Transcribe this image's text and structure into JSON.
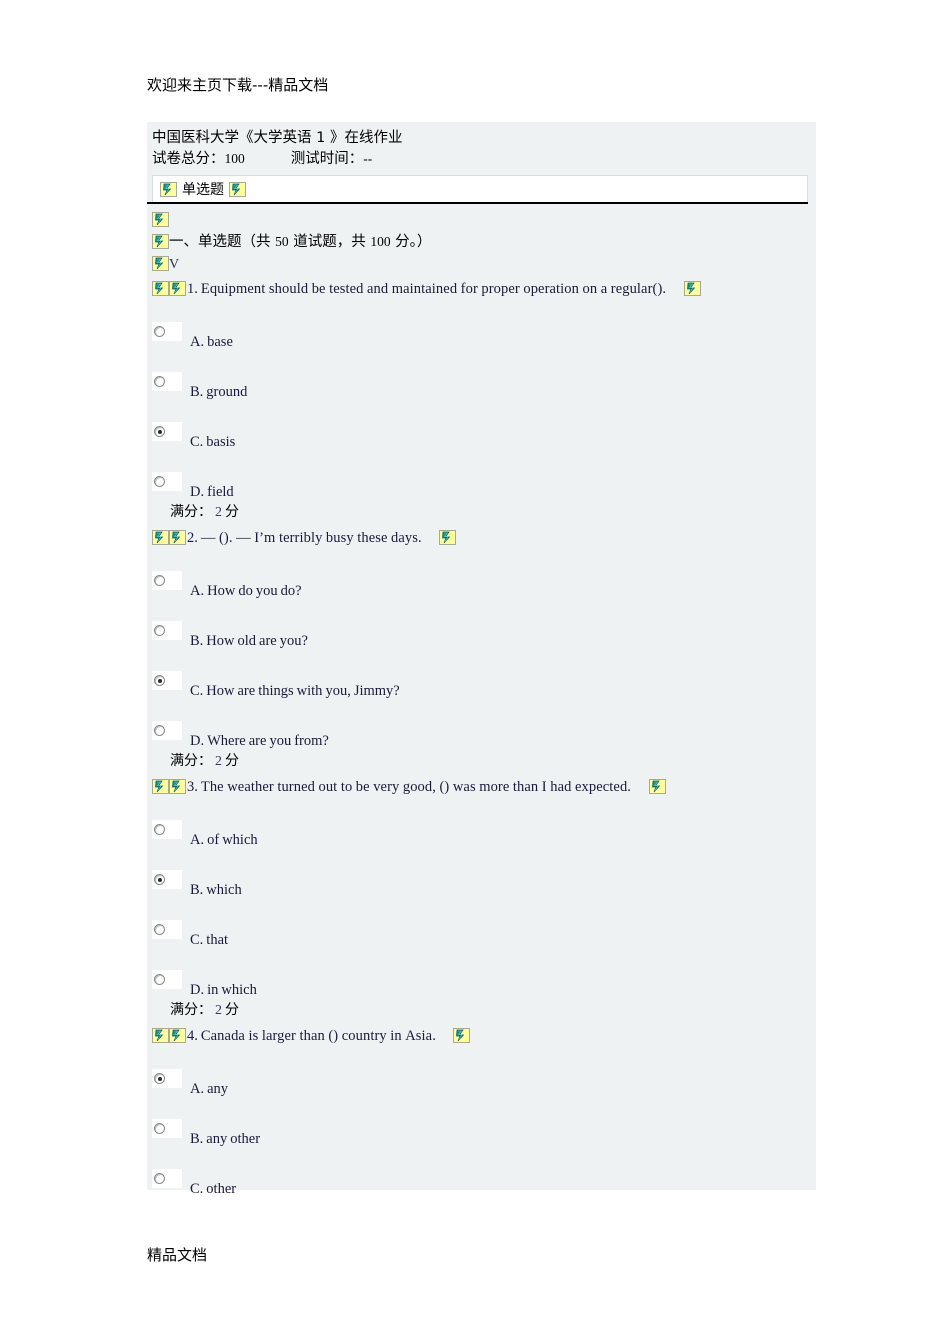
{
  "watermark": {
    "top": "欢迎来主页下载---精品文档",
    "bottom": "精品文档"
  },
  "exam": {
    "title": "中国医科大学《大学英语 1 》在线作业",
    "total_score_label": "试卷总分：",
    "total_score_value": "100",
    "test_time_label": "测试时间：",
    "test_time_value": "--",
    "tab_label": "单选题",
    "section_heading_prefix": "一、单选题（共 ",
    "section_count": "50",
    "section_heading_mid": " 道试题，共 ",
    "section_points": "100",
    "section_heading_suffix": " 分。）",
    "stray_char": "V",
    "score_prefix": "满分：",
    "score_value": "2",
    "score_suffix": "分"
  },
  "icons": {
    "broken_image": "broken-image-icon",
    "bg_color": "#ffff9e",
    "border_color": "#a8a894",
    "glyph_color": "#1a8a8a"
  },
  "questions": [
    {
      "number": "1.",
      "words": [
        "Equipment",
        "should",
        "be",
        "tested",
        "and",
        "maintained",
        "for",
        "proper",
        "operation",
        "on",
        "a",
        "regular()."
      ],
      "options": [
        {
          "label": "A.",
          "words": [
            "base"
          ],
          "checked": false
        },
        {
          "label": "B.",
          "words": [
            "ground"
          ],
          "checked": false
        },
        {
          "label": "C.",
          "words": [
            "basis"
          ],
          "checked": true
        },
        {
          "label": "D.",
          "words": [
            "field"
          ],
          "checked": false
        }
      ]
    },
    {
      "number": "2.",
      "words": [
        "—",
        "().",
        "—",
        "I’m",
        "terribly",
        "busy",
        "these",
        "days."
      ],
      "options": [
        {
          "label": "A.",
          "words": [
            "How",
            "do",
            "you",
            "do?"
          ],
          "checked": false
        },
        {
          "label": "B.",
          "words": [
            "How",
            "old",
            "are",
            "you?"
          ],
          "checked": false
        },
        {
          "label": "C.",
          "words": [
            "How",
            "are",
            "things",
            "with",
            "you,",
            "Jimmy?"
          ],
          "checked": true
        },
        {
          "label": "D.",
          "words": [
            "Where",
            "are",
            "you",
            "from?"
          ],
          "checked": false
        }
      ]
    },
    {
      "number": "3.",
      "words": [
        "The",
        "weather",
        "turned",
        "out",
        "to",
        "be",
        "very",
        "good,",
        "()",
        "was",
        "more",
        "than",
        "I",
        "had",
        "expected."
      ],
      "options": [
        {
          "label": "A.",
          "words": [
            "of",
            "which"
          ],
          "checked": false
        },
        {
          "label": "B.",
          "words": [
            "which"
          ],
          "checked": true
        },
        {
          "label": "C.",
          "words": [
            "that"
          ],
          "checked": false
        },
        {
          "label": "D.",
          "words": [
            "in",
            "which"
          ],
          "checked": false
        }
      ]
    },
    {
      "number": "4.",
      "words": [
        "Canada",
        "is",
        "larger",
        "than",
        "()",
        "country",
        "in",
        "Asia."
      ],
      "options": [
        {
          "label": "A.",
          "words": [
            "any"
          ],
          "checked": true
        },
        {
          "label": "B.",
          "words": [
            "any",
            "other"
          ],
          "checked": false
        },
        {
          "label": "C.",
          "words": [
            "other"
          ],
          "checked": false
        }
      ]
    }
  ]
}
